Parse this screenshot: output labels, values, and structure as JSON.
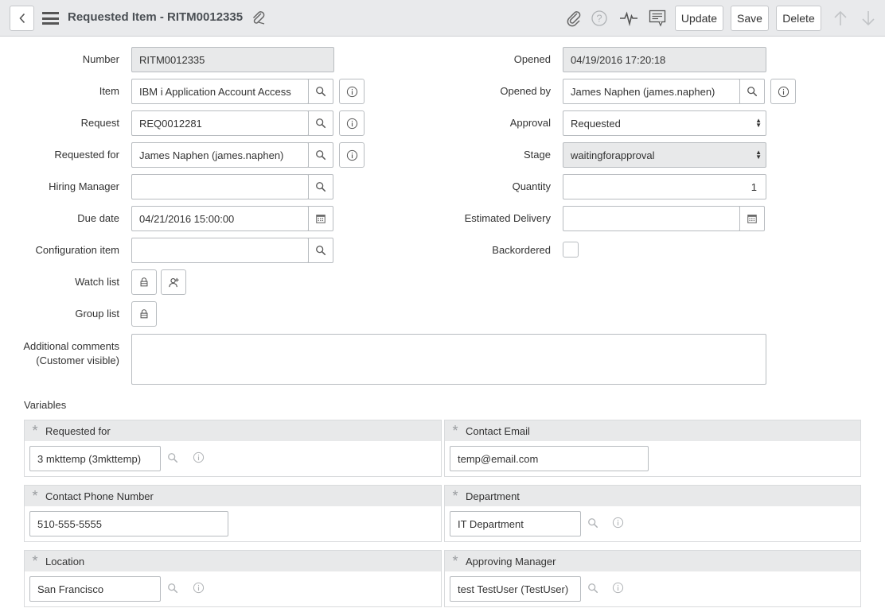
{
  "header": {
    "title": "Requested Item - RITM0012335",
    "buttons": {
      "update": "Update",
      "save": "Save",
      "delete": "Delete"
    }
  },
  "form": {
    "number": {
      "label": "Number",
      "value": "RITM0012335"
    },
    "item": {
      "label": "Item",
      "value": "IBM i Application Account Access"
    },
    "request": {
      "label": "Request",
      "value": "REQ0012281"
    },
    "requested_for": {
      "label": "Requested for",
      "value": "James Naphen (james.naphen)"
    },
    "hiring_manager": {
      "label": "Hiring Manager",
      "value": ""
    },
    "due_date": {
      "label": "Due date",
      "value": "04/21/2016 15:00:00"
    },
    "configuration_item": {
      "label": "Configuration item",
      "value": ""
    },
    "watch_list": {
      "label": "Watch list"
    },
    "group_list": {
      "label": "Group list"
    },
    "additional_comments": {
      "label_line1": "Additional comments",
      "label_line2": "(Customer visible)",
      "value": ""
    },
    "opened": {
      "label": "Opened",
      "value": "04/19/2016 17:20:18"
    },
    "opened_by": {
      "label": "Opened by",
      "value": "James Naphen (james.naphen)"
    },
    "approval": {
      "label": "Approval",
      "value": "Requested"
    },
    "stage": {
      "label": "Stage",
      "value": "waitingforapproval"
    },
    "quantity": {
      "label": "Quantity",
      "value": "1"
    },
    "estimated_delivery": {
      "label": "Estimated Delivery",
      "value": ""
    },
    "backordered": {
      "label": "Backordered",
      "checked": false
    }
  },
  "variables": {
    "heading": "Variables",
    "requested_for": {
      "label": "Requested for",
      "value": "3 mkttemp (3mkttemp)"
    },
    "contact_email": {
      "label": "Contact Email",
      "value": "temp@email.com"
    },
    "contact_phone": {
      "label": "Contact Phone Number",
      "value": "510-555-5555"
    },
    "department": {
      "label": "Department",
      "value": "IT Department"
    },
    "location": {
      "label": "Location",
      "value": "San Francisco"
    },
    "approving_manager": {
      "label": "Approving Manager",
      "value": "test TestUser (TestUser)"
    }
  },
  "icons": {
    "back": "chevron-left-icon",
    "menu": "hamburger-icon",
    "attachment": "paperclip-icon",
    "help": "question-icon",
    "activity": "pulse-icon",
    "more": "context-menu-icon",
    "prev": "arrow-up-icon",
    "next": "arrow-down-icon",
    "lookup": "search-icon",
    "info": "info-icon",
    "calendar": "calendar-icon",
    "lock": "lock-icon",
    "add_me": "add-me-icon"
  },
  "colors": {
    "header_bg": "#e9eaec",
    "readonly_bg": "#e8e9ea",
    "accent_text": "#4a4f54"
  }
}
